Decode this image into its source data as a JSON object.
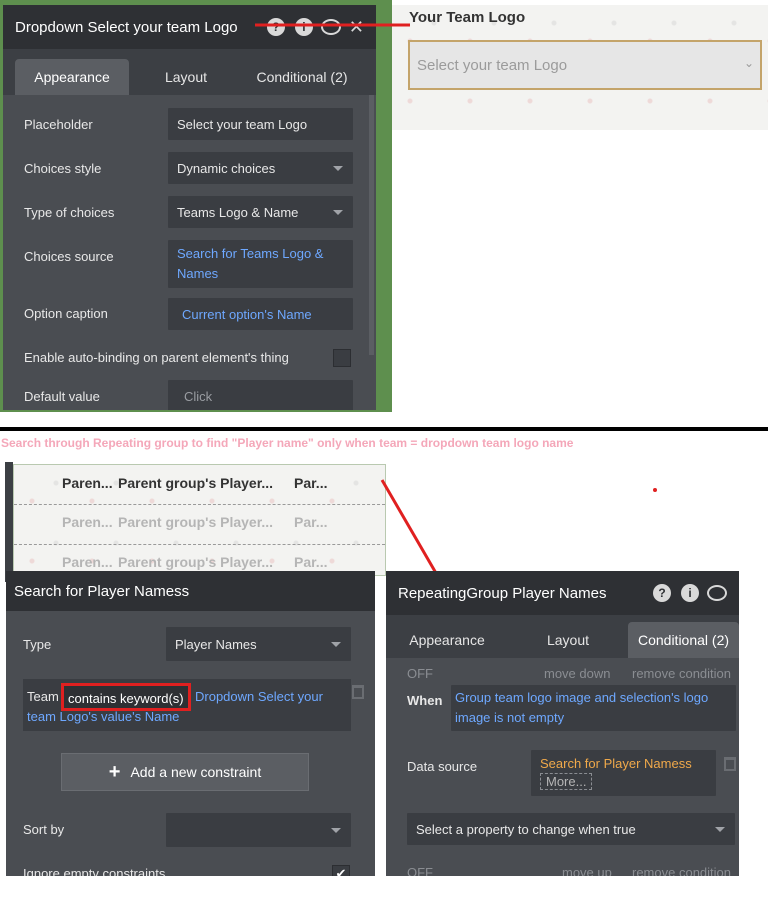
{
  "dropdown_panel": {
    "title": "Dropdown Select your team Logo",
    "tabs": [
      "Appearance",
      "Layout",
      "Conditional (2)"
    ],
    "rows": {
      "placeholder_label": "Placeholder",
      "placeholder_value": "Select your team Logo",
      "choices_style_label": "Choices style",
      "choices_style_value": "Dynamic choices",
      "type_of_choices_label": "Type of choices",
      "type_of_choices_value": "Teams Logo & Name",
      "choices_source_label": "Choices source",
      "choices_source_value": "Search for Teams Logo & Names",
      "option_caption_label": "Option caption",
      "option_caption_value": "Current option's Name",
      "autobind_label": "Enable auto-binding on parent element's thing",
      "default_value_label": "Default value",
      "default_value_value": "Click"
    }
  },
  "preview": {
    "label": "Your Team Logo",
    "dropdown_placeholder": "Select your team Logo"
  },
  "annotation": "Search through Repeating group to find \"Player name\" only when team = dropdown  team logo name",
  "repeating_group_preview": {
    "rows": [
      {
        "col1": "Paren...",
        "col2": "Parent group's Player...",
        "col3": "Par..."
      },
      {
        "col1": "Paren...",
        "col2": "Parent group's Player...",
        "col3": "Par..."
      },
      {
        "col1": "Paren...",
        "col2": "Parent group's Player...",
        "col3": "Par..."
      }
    ]
  },
  "search_panel": {
    "title": "Search for Player Namess",
    "type_label": "Type",
    "type_value": "Player Names",
    "constraint_field": "Team",
    "constraint_operator": "contains keyword(s)",
    "constraint_value": "Dropdown Select your team Logo's value's Name",
    "add_constraint_label": "Add a new constraint",
    "sort_by_label": "Sort by",
    "ignore_empty_label": "Ignore empty constraints"
  },
  "rg_panel": {
    "title": "RepeatingGroup Player Names",
    "tabs": [
      "Appearance",
      "Layout",
      "Conditional (2)"
    ],
    "condition_off_label": "OFF",
    "move_down_label": "move down",
    "remove_condition_label": "remove condition",
    "when_label": "When",
    "when_value": "Group team logo image and selection's logo image is not empty",
    "data_source_label": "Data source",
    "data_source_value": "Search for Player Namess",
    "more_label": "More...",
    "property_select_placeholder": "Select a property to change when true",
    "condition2_off_label": "OFF",
    "move_up_label": "move up",
    "remove_condition2_label": "remove condition"
  },
  "colors": {
    "panel_bg": "#4a4d52",
    "header_bg": "#2e3034",
    "accent_blue": "#6ea8ff",
    "accent_orange": "#f0a94a",
    "annotation_red": "#e02020",
    "annotation_pink": "#f4a7b9"
  }
}
